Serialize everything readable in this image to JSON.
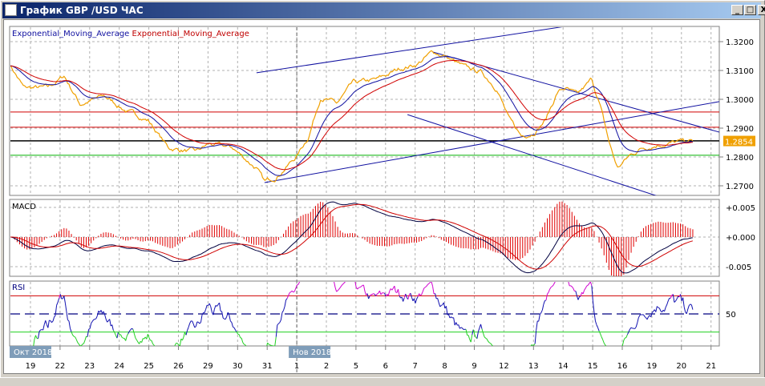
{
  "window": {
    "title": "График GBP /USD  ЧАС",
    "minimize": "_",
    "maximize": "□",
    "close": "X"
  },
  "price_panel": {
    "legend": [
      {
        "label": "Exponential_Moving_Average",
        "color": "#1010a0"
      },
      {
        "label": "Exponential_Moving_Average",
        "color": "#c00000"
      }
    ],
    "axis_labels": [
      "1.3200",
      "1.3100",
      "1.3000",
      "1.2900",
      "1.2800",
      "1.2700"
    ],
    "axis_values": [
      1.32,
      1.31,
      1.3,
      1.29,
      1.28,
      1.27
    ],
    "current_price": "1.2854",
    "current_price_value": 1.2854,
    "horizontal_lines": [
      {
        "price": 1.2956,
        "color": "#d00000"
      },
      {
        "price": 1.2903,
        "color": "#d00000"
      },
      {
        "price": 1.2856,
        "color": "#000000"
      },
      {
        "price": 1.2806,
        "color": "#00b000"
      }
    ],
    "trendlines": [
      {
        "from": [
          7.64,
          1.3092
        ],
        "to": [
          18.08,
          1.3253
        ]
      },
      {
        "from": [
          7.91,
          1.2711
        ],
        "to": [
          23.28,
          1.2992
        ]
      },
      {
        "from": [
          13.6,
          1.3164
        ],
        "to": [
          23.28,
          1.2886
        ]
      },
      {
        "from": [
          12.74,
          1.2947
        ],
        "to": [
          20.87,
          1.2675
        ]
      }
    ],
    "price_path": [
      [
        -0.7,
        1.3122
      ],
      [
        -0.22,
        1.3039
      ],
      [
        0.6,
        1.3039
      ],
      [
        1.14,
        1.3081
      ],
      [
        1.68,
        1.2983
      ],
      [
        2.49,
        1.3011
      ],
      [
        3.31,
        1.2956
      ],
      [
        3.98,
        1.2928
      ],
      [
        4.66,
        1.2831
      ],
      [
        5.61,
        1.2817
      ],
      [
        6.02,
        1.2844
      ],
      [
        6.83,
        1.2831
      ],
      [
        7.64,
        1.2761
      ],
      [
        7.91,
        1.2711
      ],
      [
        8.32,
        1.2733
      ],
      [
        9.0,
        1.2803
      ],
      [
        9.4,
        1.2872
      ],
      [
        9.81,
        1.3011
      ],
      [
        10.35,
        1.2983
      ],
      [
        10.89,
        1.3053
      ],
      [
        11.71,
        1.3067
      ],
      [
        12.52,
        1.3108
      ],
      [
        13.06,
        1.3122
      ],
      [
        13.6,
        1.3164
      ],
      [
        14.01,
        1.315
      ],
      [
        14.69,
        1.3108
      ],
      [
        15.23,
        1.3094
      ],
      [
        15.77,
        1.3039
      ],
      [
        16.18,
        1.2928
      ],
      [
        16.59,
        1.2872
      ],
      [
        16.99,
        1.2886
      ],
      [
        17.4,
        1.2928
      ],
      [
        17.81,
        1.3025
      ],
      [
        18.08,
        1.3039
      ],
      [
        18.48,
        1.3011
      ],
      [
        18.97,
        1.3067
      ],
      [
        19.24,
        1.2983
      ],
      [
        19.57,
        1.2844
      ],
      [
        19.84,
        1.2761
      ],
      [
        20.24,
        1.2803
      ],
      [
        20.65,
        1.2831
      ],
      [
        21.19,
        1.2844
      ],
      [
        21.73,
        1.285
      ],
      [
        22.41,
        1.2854
      ]
    ]
  },
  "macd_panel": {
    "label": "MACD",
    "axis_labels": [
      "+0.005",
      "+0.000",
      "-0.005"
    ],
    "axis_values": [
      0.005,
      0,
      -0.005
    ]
  },
  "rsi_panel": {
    "label": "RSI",
    "axis_label": "50",
    "levels": [
      70,
      50,
      30
    ]
  },
  "time_axis": {
    "dates": [
      "19",
      "22",
      "23",
      "24",
      "25",
      "26",
      "29",
      "30",
      "31",
      "1",
      "2",
      "5",
      "6",
      "7",
      "8",
      "9",
      "12",
      "13",
      "14",
      "15",
      "16",
      "19",
      "20",
      "21"
    ],
    "month_labels": [
      {
        "label": "Окт 2018",
        "day_index": 0
      },
      {
        "label": "Нов 2018",
        "day_index": 9
      }
    ]
  },
  "colors": {
    "price": "#f0a000",
    "ema_fast": "#1010a0",
    "ema_slow": "#d00000",
    "grid": "#b0b0b0",
    "rsi_over": "#d000d0",
    "rsi_under": "#20d020",
    "rsi_mid": "#1010b0"
  }
}
